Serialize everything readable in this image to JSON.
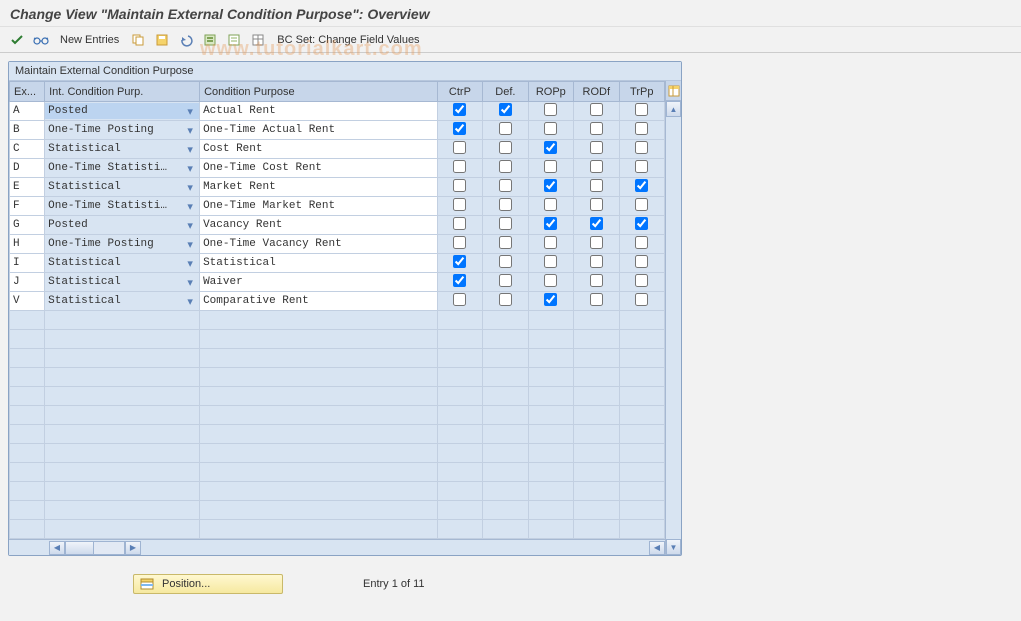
{
  "header": {
    "title": "Change View \"Maintain External Condition Purpose\": Overview"
  },
  "toolbar": {
    "newEntries": "New Entries",
    "bcSet": "BC Set: Change Field Values"
  },
  "watermark": "www.tutorialkart.com",
  "panel": {
    "title": "Maintain External Condition Purpose"
  },
  "columns": {
    "ex": "Ex...",
    "intCond": "Int. Condition Purp.",
    "condPurpose": "Condition Purpose",
    "ctrP": "CtrP",
    "def": "Def.",
    "ropp": "ROPp",
    "rodf": "RODf",
    "trpp": "TrPp"
  },
  "rows": [
    {
      "ex": "A",
      "intCond": "Posted",
      "condPurpose": "Actual Rent",
      "ctrP": true,
      "def": true,
      "ropp": false,
      "rodf": false,
      "trpp": false,
      "selected": true
    },
    {
      "ex": "B",
      "intCond": "One-Time Posting",
      "condPurpose": "One-Time Actual Rent",
      "ctrP": true,
      "def": false,
      "ropp": false,
      "rodf": false,
      "trpp": false
    },
    {
      "ex": "C",
      "intCond": "Statistical",
      "condPurpose": "Cost Rent",
      "ctrP": false,
      "def": false,
      "ropp": true,
      "rodf": false,
      "trpp": false
    },
    {
      "ex": "D",
      "intCond": "One-Time Statisti…",
      "condPurpose": "One-Time Cost Rent",
      "ctrP": false,
      "def": false,
      "ropp": false,
      "rodf": false,
      "trpp": false
    },
    {
      "ex": "E",
      "intCond": "Statistical",
      "condPurpose": "Market Rent",
      "ctrP": false,
      "def": false,
      "ropp": true,
      "rodf": false,
      "trpp": true
    },
    {
      "ex": "F",
      "intCond": "One-Time Statisti…",
      "condPurpose": "One-Time Market Rent",
      "ctrP": false,
      "def": false,
      "ropp": false,
      "rodf": false,
      "trpp": false
    },
    {
      "ex": "G",
      "intCond": "Posted",
      "condPurpose": "Vacancy Rent",
      "ctrP": false,
      "def": false,
      "ropp": true,
      "rodf": true,
      "trpp": true
    },
    {
      "ex": "H",
      "intCond": "One-Time Posting",
      "condPurpose": "One-Time Vacancy Rent",
      "ctrP": false,
      "def": false,
      "ropp": false,
      "rodf": false,
      "trpp": false
    },
    {
      "ex": "I",
      "intCond": "Statistical",
      "condPurpose": "Statistical",
      "ctrP": true,
      "def": false,
      "ropp": false,
      "rodf": false,
      "trpp": false
    },
    {
      "ex": "J",
      "intCond": "Statistical",
      "condPurpose": "Waiver",
      "ctrP": true,
      "def": false,
      "ropp": false,
      "rodf": false,
      "trpp": false
    },
    {
      "ex": "V",
      "intCond": "Statistical",
      "condPurpose": "Comparative Rent",
      "ctrP": false,
      "def": false,
      "ropp": true,
      "rodf": false,
      "trpp": false
    }
  ],
  "emptyRows": 12,
  "footer": {
    "positionLabel": "Position...",
    "entryText": "Entry 1 of 11"
  }
}
